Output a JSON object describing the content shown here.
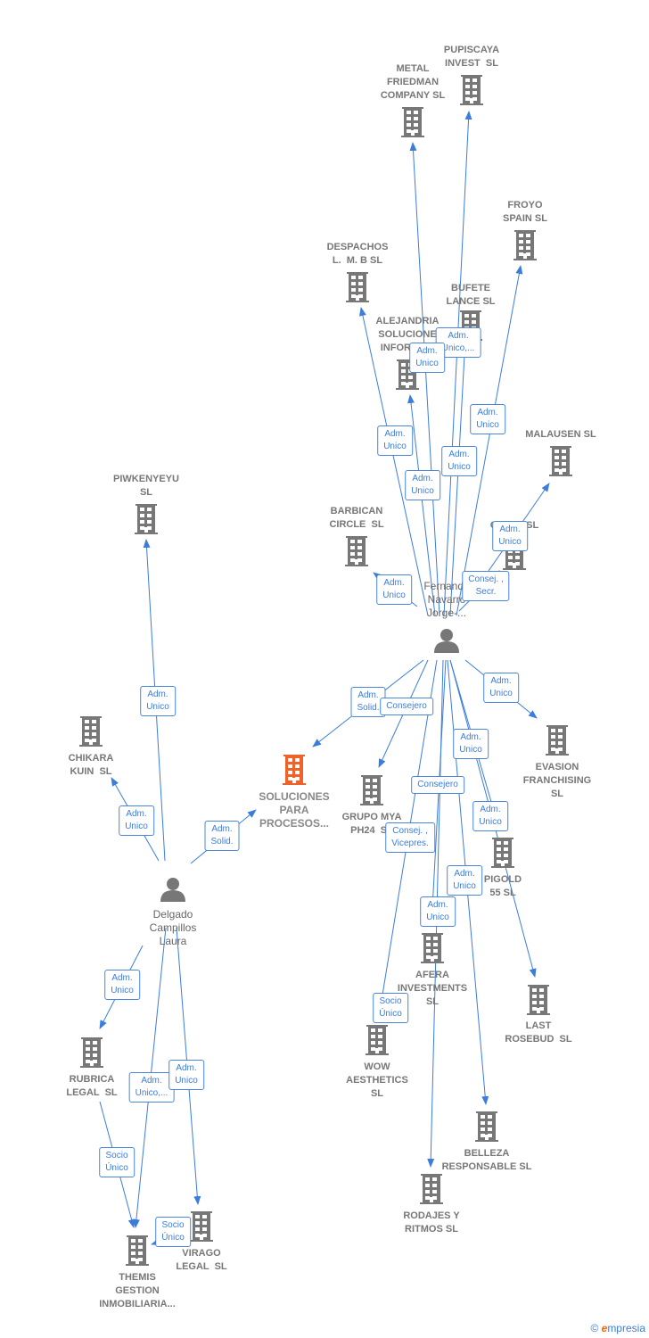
{
  "colors": {
    "edge": "#3b7ddd",
    "company": "#777777",
    "main_company": "#f0622c",
    "person": "#777777"
  },
  "nodes": [
    {
      "type": "person",
      "label": "Fernando\nNavarro\nJorge-..."
    },
    {
      "type": "person",
      "label": "Delgado\nCampillos\nLaura"
    },
    {
      "type": "main",
      "label": "SOLUCIONES\nPARA\nPROCESOS..."
    },
    {
      "type": "company",
      "label": "PUPISCAYA\nINVEST  SL"
    },
    {
      "type": "company",
      "label": "METAL\nFRIEDMAN\nCOMPANY SL"
    },
    {
      "type": "company",
      "label": "FROYO\nSPAIN SL"
    },
    {
      "type": "company",
      "label": "DESPACHOS\nL.  M. B SL"
    },
    {
      "type": "company",
      "label": "BUFETE\nLANCE SL"
    },
    {
      "type": "company",
      "label": "ALEJANDRIA\nSOLUCIONE\nINFORMA..."
    },
    {
      "type": "company",
      "label": "MALAUSEN SL"
    },
    {
      "type": "company",
      "label": "BARBICAN\nCIRCLE  SL"
    },
    {
      "type": "company",
      "label": "OV        SL"
    },
    {
      "type": "company",
      "label": "PIWKENYEYU\nSL"
    },
    {
      "type": "company",
      "label": "CHIKARA\nKUIN  SL"
    },
    {
      "type": "company",
      "label": "EVASION\nFRANCHISING\nSL"
    },
    {
      "type": "company",
      "label": "GRUPO MYA\nPH24  SL"
    },
    {
      "type": "company",
      "label": "PIGOLD\n55 SL"
    },
    {
      "type": "company",
      "label": "AFERA\nINVESTMENTS\nSL"
    },
    {
      "type": "company",
      "label": "LAST\nROSEBUD  SL"
    },
    {
      "type": "company",
      "label": "WOW\nAESTHETICS\nSL"
    },
    {
      "type": "company",
      "label": "RUBRICA\nLEGAL  SL"
    },
    {
      "type": "company",
      "label": "BELLEZA\nRESPONSABLE SL"
    },
    {
      "type": "company",
      "label": "RODAJES Y\nRITMOS SL"
    },
    {
      "type": "company",
      "label": "VIRAGO\nLEGAL  SL"
    },
    {
      "type": "company",
      "label": "THEMIS\nGESTION\nINMOBILIARIA..."
    }
  ],
  "edges": [
    {
      "from": 0,
      "to": 3,
      "role": "Adm.\nUnico,..."
    },
    {
      "from": 0,
      "to": 4,
      "role": "Adm.\nUnico"
    },
    {
      "from": 0,
      "to": 5,
      "role": "Adm.\nUnico"
    },
    {
      "from": 0,
      "to": 6,
      "role": "Adm.\nUnico"
    },
    {
      "from": 0,
      "to": 7,
      "role": "Adm.\nUnico"
    },
    {
      "from": 0,
      "to": 8,
      "role": "Adm.\nUnico"
    },
    {
      "from": 0,
      "to": 9,
      "role": "Adm.\nUnico"
    },
    {
      "from": 0,
      "to": 10,
      "role": "Adm.\nUnico"
    },
    {
      "from": 0,
      "to": 11,
      "role": "Consej. ,\nSecr."
    },
    {
      "from": 0,
      "to": 14,
      "role": "Adm.\nUnico"
    },
    {
      "from": 0,
      "to": 2,
      "role": "Adm.\nSolid."
    },
    {
      "from": 0,
      "to": 15,
      "role": "Consejero"
    },
    {
      "from": 0,
      "to": 16,
      "role": "Adm.\nUnico"
    },
    {
      "from": 0,
      "to": 18,
      "role": "Adm.\nUnico"
    },
    {
      "from": 0,
      "to": 21,
      "role": "Adm.\nUnico"
    },
    {
      "from": 0,
      "to": 22,
      "role": "Consejero"
    },
    {
      "from": 0,
      "to": 19,
      "role": "Consej. ,\nVicepres."
    },
    {
      "from": 0,
      "to": 17,
      "role": "Adm.\nUnico"
    },
    {
      "from": 17,
      "to": 19,
      "role": "Socio\nÚnico"
    },
    {
      "from": 1,
      "to": 12,
      "role": "Adm.\nUnico"
    },
    {
      "from": 1,
      "to": 13,
      "role": "Adm.\nUnico"
    },
    {
      "from": 1,
      "to": 2,
      "role": "Adm.\nSolid."
    },
    {
      "from": 1,
      "to": 20,
      "role": "Adm.\nUnico"
    },
    {
      "from": 1,
      "to": 24,
      "role": "Adm.\nUnico,..."
    },
    {
      "from": 1,
      "to": 23,
      "role": "Adm.\nUnico"
    },
    {
      "from": 20,
      "to": 24,
      "role": "Socio\nÚnico"
    },
    {
      "from": 23,
      "to": 24,
      "role": "Socio\nÚnico"
    }
  ],
  "footer": {
    "copyright": "©",
    "brand_initial": "e",
    "brand_rest": "mpresia"
  }
}
